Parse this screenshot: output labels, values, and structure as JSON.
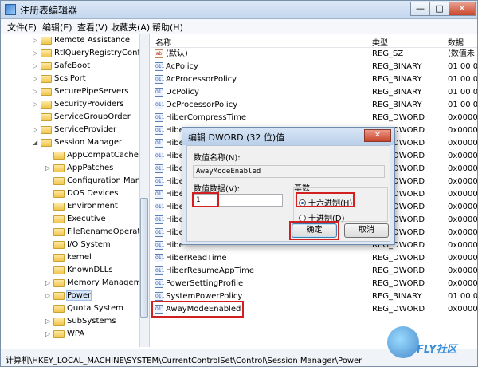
{
  "window": {
    "title": "注册表编辑器",
    "minimize_label": "—",
    "maximize_label": "□",
    "close_label": "✕"
  },
  "menu": [
    "文件(F)",
    "编辑(E)",
    "查看(V)",
    "收藏夹(A)",
    "帮助(H)"
  ],
  "tree": {
    "items": [
      {
        "label": "Remote Assistance",
        "expander": "▷"
      },
      {
        "label": "RtlQueryRegistryConfig",
        "expander": "▷"
      },
      {
        "label": "SafeBoot",
        "expander": "▷"
      },
      {
        "label": "ScsiPort",
        "expander": "▷"
      },
      {
        "label": "SecurePipeServers",
        "expander": "▷"
      },
      {
        "label": "SecurityProviders",
        "expander": "▷"
      },
      {
        "label": "ServiceGroupOrder",
        "expander": ""
      },
      {
        "label": "ServiceProvider",
        "expander": "▷"
      },
      {
        "label": "Session Manager",
        "expander": "◢"
      },
      {
        "label": "AppCompatCache",
        "expander": ""
      },
      {
        "label": "AppPatches",
        "expander": "▷"
      },
      {
        "label": "Configuration Mana",
        "expander": ""
      },
      {
        "label": "DOS Devices",
        "expander": ""
      },
      {
        "label": "Environment",
        "expander": ""
      },
      {
        "label": "Executive",
        "expander": ""
      },
      {
        "label": "FileRenameOperatio",
        "expander": ""
      },
      {
        "label": "I/O System",
        "expander": ""
      },
      {
        "label": "kernel",
        "expander": ""
      },
      {
        "label": "KnownDLLs",
        "expander": ""
      },
      {
        "label": "Memory Managem",
        "expander": "▷"
      },
      {
        "label": "Power",
        "expander": "▷"
      },
      {
        "label": "Quota System",
        "expander": ""
      },
      {
        "label": "SubSystems",
        "expander": "▷"
      },
      {
        "label": "WPA",
        "expander": "▷"
      }
    ]
  },
  "list": {
    "headers": {
      "name": "名称",
      "type": "类型",
      "data": "数据"
    },
    "rows": [
      {
        "icon": "ab",
        "name": "(默认)",
        "type": "REG_SZ",
        "data": "(数值未"
      },
      {
        "icon": "011",
        "name": "AcPolicy",
        "type": "REG_BINARY",
        "data": "01 00 0"
      },
      {
        "icon": "011",
        "name": "AcProcessorPolicy",
        "type": "REG_BINARY",
        "data": "01 00 0"
      },
      {
        "icon": "011",
        "name": "DcPolicy",
        "type": "REG_BINARY",
        "data": "01 00 0"
      },
      {
        "icon": "011",
        "name": "DcProcessorPolicy",
        "type": "REG_BINARY",
        "data": "01 00 0"
      },
      {
        "icon": "011",
        "name": "HiberCompressTime",
        "type": "REG_DWORD",
        "data": "0x0000"
      },
      {
        "icon": "011",
        "name": "Hibe",
        "type": "REG_DWORD",
        "data": "0x0000"
      },
      {
        "icon": "011",
        "name": "Hibe",
        "type": "REG_DWORD",
        "data": "0x0000"
      },
      {
        "icon": "011",
        "name": "Hibe",
        "type": "REG_DWORD",
        "data": "0x0000"
      },
      {
        "icon": "011",
        "name": "Hibe",
        "type": "REG_DWORD",
        "data": "0x0000"
      },
      {
        "icon": "011",
        "name": "Hibe",
        "type": "REG_DWORD",
        "data": "0x0000"
      },
      {
        "icon": "011",
        "name": "Hibe",
        "type": "REG_DWORD",
        "data": "0x0000"
      },
      {
        "icon": "011",
        "name": "Hibe",
        "type": "REG_DWORD",
        "data": "0x0000"
      },
      {
        "icon": "011",
        "name": "Hibe",
        "type": "REG_DWORD",
        "data": "0x0000"
      },
      {
        "icon": "011",
        "name": "Hibe",
        "type": "REG_DWORD",
        "data": "0x0000"
      },
      {
        "icon": "011",
        "name": "Hibe",
        "type": "REG_DWORD",
        "data": "0x0000"
      },
      {
        "icon": "011",
        "name": "HiberReadTime",
        "type": "REG_DWORD",
        "data": "0x0000"
      },
      {
        "icon": "011",
        "name": "HiberResumeAppTime",
        "type": "REG_DWORD",
        "data": "0x0000"
      },
      {
        "icon": "011",
        "name": "PowerSettingProfile",
        "type": "REG_DWORD",
        "data": "0x0000"
      },
      {
        "icon": "011",
        "name": "SystemPowerPolicy",
        "type": "REG_BINARY",
        "data": "01 00 0"
      },
      {
        "icon": "011",
        "name": "AwayModeEnabled",
        "type": "REG_DWORD",
        "data": "0x0000"
      }
    ]
  },
  "dialog": {
    "title": "编辑 DWORD (32 位)值",
    "close_label": "✕",
    "name_label": "数值名称(N):",
    "name_value": "AwayModeEnabled",
    "data_label": "数值数据(V):",
    "data_value": "1",
    "base_label": "基数",
    "radio_hex": "十六进制(H)",
    "radio_dec": "十进制(D)",
    "ok_label": "确定",
    "cancel_label": "取消"
  },
  "statusbar": {
    "path": "计算机\\HKEY_LOCAL_MACHINE\\SYSTEM\\CurrentControlSet\\Control\\Session Manager\\Power"
  },
  "watermark": {
    "text": "FLY社区"
  },
  "colors": {
    "highlight": "#d21f1f",
    "selection": "#d9e7f8",
    "titlebar": "#c4d7ee"
  }
}
